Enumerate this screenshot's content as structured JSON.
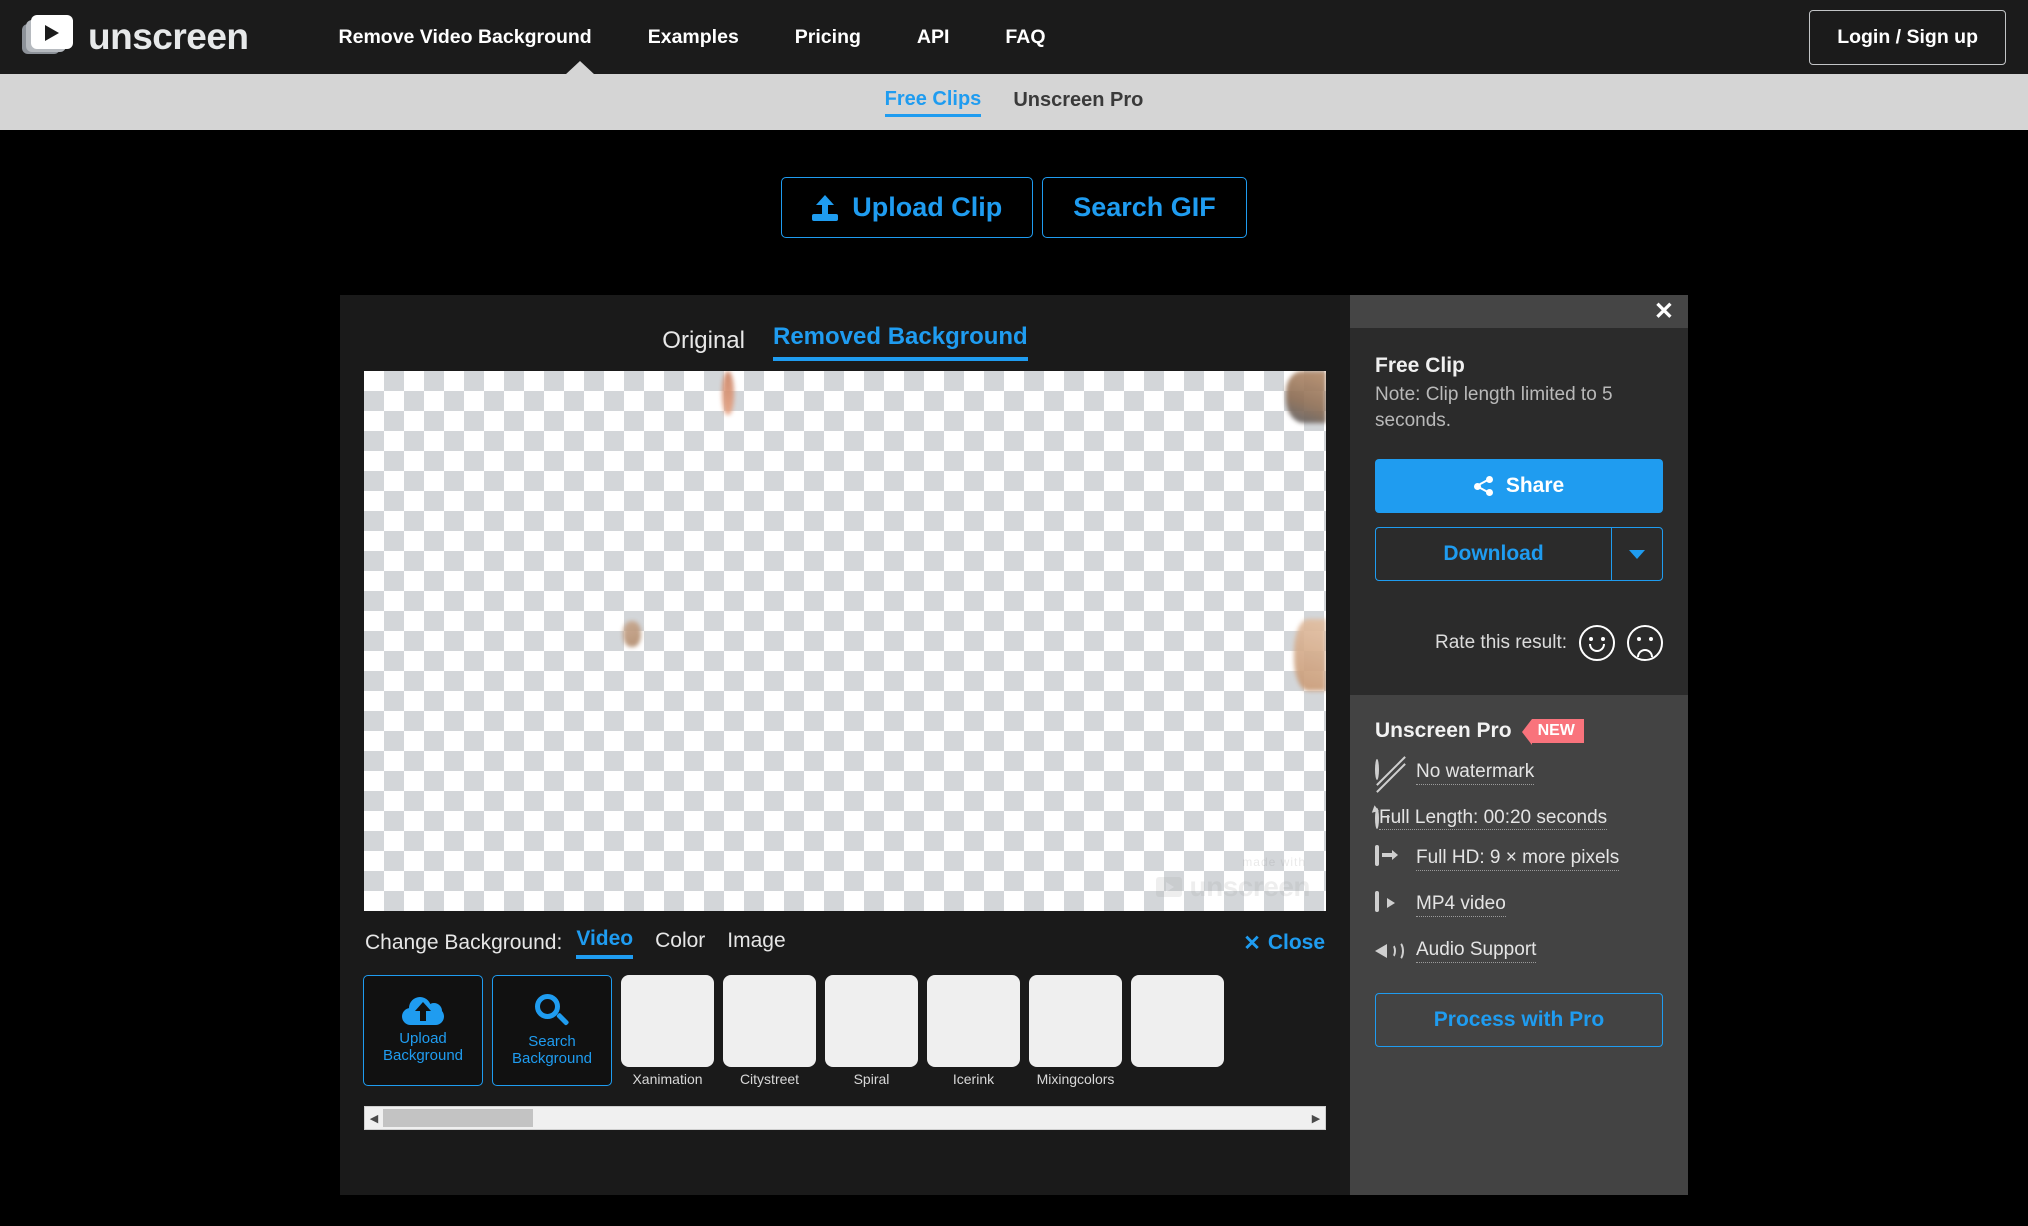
{
  "header": {
    "brand": "unscreen",
    "nav": [
      {
        "label": "Remove Video Background"
      },
      {
        "label": "Examples"
      },
      {
        "label": "Pricing"
      },
      {
        "label": "API"
      },
      {
        "label": "FAQ"
      }
    ],
    "login_label": "Login / Sign up"
  },
  "subnav": {
    "items": [
      {
        "label": "Free Clips",
        "active": true
      },
      {
        "label": "Unscreen Pro",
        "active": false
      }
    ]
  },
  "actions": {
    "upload_label": "Upload Clip",
    "search_gif_label": "Search GIF"
  },
  "editor": {
    "view_tabs": [
      {
        "label": "Original",
        "active": false
      },
      {
        "label": "Removed Background",
        "active": true
      }
    ],
    "watermark": {
      "small": "made with",
      "text": "unscreen"
    },
    "change_background": {
      "label": "Change Background:",
      "tabs": [
        {
          "label": "Video",
          "active": true
        },
        {
          "label": "Color",
          "active": false
        },
        {
          "label": "Image",
          "active": false
        }
      ],
      "close_label": "Close",
      "close_icon": "x-icon"
    },
    "thumb_actions": [
      {
        "label": "Upload\nBackground",
        "icon": "cloud-upload-icon"
      },
      {
        "label": "Search\nBackground",
        "icon": "magnifier-icon"
      }
    ],
    "thumbs": [
      {
        "caption": "Xanimation"
      },
      {
        "caption": "Citystreet"
      },
      {
        "caption": "Spiral"
      },
      {
        "caption": "Icerink"
      },
      {
        "caption": "Mixingcolors"
      },
      {
        "caption": ""
      }
    ],
    "scroll": {
      "left_arrow": "◀",
      "right_arrow": "▶"
    }
  },
  "panel": {
    "close_icon": "close-icon",
    "title": "Free Clip",
    "note": "Note: Clip length limited to 5 seconds.",
    "share_label": "Share",
    "download_label": "Download",
    "rate_label": "Rate this result:",
    "pro": {
      "title": "Unscreen Pro",
      "badge": "NEW",
      "features": [
        {
          "label": "No watermark",
          "icon": "no-watermark-icon",
          "wrap": false
        },
        {
          "label": "Full Length: 00:20 seconds",
          "icon": "clock-icon",
          "wrap": true
        },
        {
          "label": "Full HD: 9 × more pixels",
          "icon": "hd-monitor-icon",
          "wrap": false
        },
        {
          "label": "MP4 video",
          "icon": "video-icon",
          "wrap": false
        },
        {
          "label": "Audio Support",
          "icon": "speaker-icon",
          "wrap": false
        }
      ],
      "cta_label": "Process with Pro"
    }
  },
  "colors": {
    "accent": "#1f9cf0",
    "badge": "#f9737c",
    "nav_bg": "#1b1b1b",
    "subnav_bg": "#d5d5d5",
    "card_bg": "#1a1a1a",
    "panel_bg": "#2b2b2b",
    "pro_bg": "#434343"
  }
}
